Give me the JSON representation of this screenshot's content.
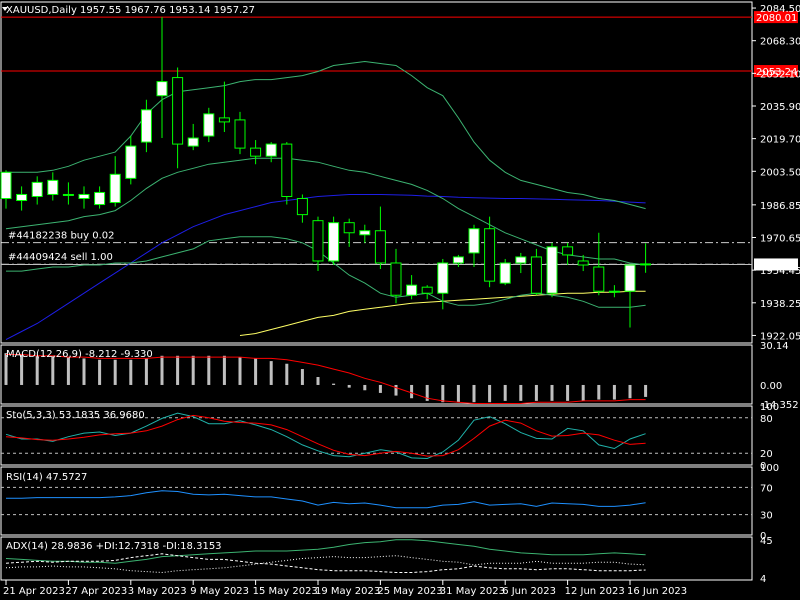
{
  "symbol_header": "XAUUSD,Daily  1957.55 1967.76 1953.14 1957.27",
  "colors": {
    "background": "#000000",
    "frame": "#ffffff",
    "bull_body": "#ffffff",
    "bear_body": "#000000",
    "wick": "#00ff00",
    "bollinger": "#3cb371",
    "ma_blue": "#1e1ee6",
    "ma_yellow": "#ffff66",
    "resistance_line": "#ff0000",
    "price_tag_red": "#ff0000",
    "macd_hist": "#c0c0c0",
    "macd_signal": "#ff0000",
    "stoch_main": "#20b2aa",
    "stoch_signal": "#ff0000",
    "rsi": "#1e90ff",
    "adx": "#3cb371",
    "di": "#ffffff",
    "level_dashed": "#ffffff"
  },
  "main_panel": {
    "price_axis_ticks": [
      "2084.50",
      "2068.30",
      "2052.10",
      "2035.90",
      "2019.70",
      "2003.50",
      "1986.85",
      "1970.65",
      "1954.45",
      "1938.25",
      "1922.05"
    ],
    "red_tags": [
      "2080.01",
      "2053.24"
    ],
    "current_price_tag": "1957.27",
    "orders": [
      {
        "label": "#44182238 buy 0.02",
        "price": 1968.1
      },
      {
        "label": "#44409424 sell 1.00",
        "price": 1957.4
      }
    ],
    "resistance_levels": [
      2080.01,
      2053.24
    ]
  },
  "macd_panel": {
    "label": "MACD(12,26,9) -8.212 -9.330",
    "axis_ticks": [
      "30.14",
      "0.00",
      "-14.352"
    ]
  },
  "stoch_panel": {
    "label": "Sto(5,3,3) 53.1835 36.9680",
    "axis_ticks": [
      "100",
      "80",
      "20",
      "0"
    ]
  },
  "rsi_panel": {
    "label": "RSI(14) 47.5727",
    "axis_ticks": [
      "100",
      "70",
      "30",
      "0"
    ]
  },
  "adx_panel": {
    "label": "ADX(14) 28.9836 +DI:12.7318 -DI:18.3153",
    "axis_ticks": [
      "45",
      "4"
    ]
  },
  "date_axis": [
    "21 Apr 2023",
    "27 Apr 2023",
    "3 May 2023",
    "9 May 2023",
    "15 May 2023",
    "19 May 2023",
    "25 May 2023",
    "31 May 2023",
    "6 Jun 2023",
    "12 Jun 2023",
    "16 Jun 2023"
  ],
  "chart_data": {
    "type": "candlestick",
    "candles": [
      {
        "o": 1990,
        "h": 2004,
        "c": 2003,
        "l": 1985
      },
      {
        "o": 1989,
        "h": 1996,
        "c": 1992,
        "l": 1984
      },
      {
        "o": 1991,
        "h": 2001,
        "c": 1998,
        "l": 1987
      },
      {
        "o": 1992,
        "h": 2003,
        "c": 1999,
        "l": 1989
      },
      {
        "o": 1992,
        "h": 1998,
        "c": 1992,
        "l": 1987
      },
      {
        "o": 1990,
        "h": 1996,
        "c": 1992,
        "l": 1985
      },
      {
        "o": 1987,
        "h": 1996,
        "c": 1993,
        "l": 1985
      },
      {
        "o": 1988,
        "h": 2011,
        "c": 2002,
        "l": 1986
      },
      {
        "o": 2000,
        "h": 2021,
        "c": 2016,
        "l": 1997
      },
      {
        "o": 2018,
        "h": 2039,
        "c": 2034,
        "l": 2013
      },
      {
        "o": 2041,
        "h": 2080,
        "c": 2048,
        "l": 2020
      },
      {
        "o": 2050,
        "h": 2055,
        "c": 2017,
        "l": 2005
      },
      {
        "o": 2016,
        "h": 2027,
        "c": 2020,
        "l": 2014
      },
      {
        "o": 2021,
        "h": 2035,
        "c": 2032,
        "l": 2018
      },
      {
        "o": 2030,
        "h": 2048,
        "c": 2028,
        "l": 2023
      },
      {
        "o": 2029,
        "h": 2033,
        "c": 2015,
        "l": 2012
      },
      {
        "o": 2015,
        "h": 2019,
        "c": 2011,
        "l": 2007
      },
      {
        "o": 2011,
        "h": 2018,
        "c": 2017,
        "l": 2008
      },
      {
        "o": 2017,
        "h": 2018,
        "c": 1991,
        "l": 1987
      },
      {
        "o": 1990,
        "h": 1992,
        "c": 1982,
        "l": 1978
      },
      {
        "o": 1979,
        "h": 1981,
        "c": 1959,
        "l": 1954
      },
      {
        "o": 1959,
        "h": 1981,
        "c": 1978,
        "l": 1957
      },
      {
        "o": 1978,
        "h": 1980,
        "c": 1973,
        "l": 1966
      },
      {
        "o": 1972,
        "h": 1977,
        "c": 1974,
        "l": 1968
      },
      {
        "o": 1974,
        "h": 1986,
        "c": 1958,
        "l": 1955
      },
      {
        "o": 1958,
        "h": 1965,
        "c": 1942,
        "l": 1938
      },
      {
        "o": 1942,
        "h": 1952,
        "c": 1947,
        "l": 1940
      },
      {
        "o": 1946,
        "h": 1947,
        "c": 1943,
        "l": 1940
      },
      {
        "o": 1943,
        "h": 1960,
        "c": 1958,
        "l": 1935
      },
      {
        "o": 1958,
        "h": 1962,
        "c": 1961,
        "l": 1956
      },
      {
        "o": 1963,
        "h": 1977,
        "c": 1975,
        "l": 1956
      },
      {
        "o": 1975,
        "h": 1981,
        "c": 1949,
        "l": 1946
      },
      {
        "o": 1948,
        "h": 1960,
        "c": 1958,
        "l": 1947
      },
      {
        "o": 1958,
        "h": 1963,
        "c": 1961,
        "l": 1953
      },
      {
        "o": 1961,
        "h": 1965,
        "c": 1943,
        "l": 1942
      },
      {
        "o": 1943,
        "h": 1968,
        "c": 1966,
        "l": 1941
      },
      {
        "o": 1966,
        "h": 1968,
        "c": 1962,
        "l": 1957
      },
      {
        "o": 1959,
        "h": 1962,
        "c": 1957,
        "l": 1954
      },
      {
        "o": 1956,
        "h": 1973,
        "c": 1944,
        "l": 1942
      },
      {
        "o": 1944,
        "h": 1947,
        "c": 1944,
        "l": 1941
      },
      {
        "o": 1944,
        "h": 1946,
        "c": 1957,
        "l": 1926
      },
      {
        "o": 1957.55,
        "h": 1967.76,
        "c": 1957.27,
        "l": 1953.14
      }
    ],
    "bollinger_upper": [
      2003,
      2003,
      2003,
      2004,
      2006,
      2009,
      2011,
      2013,
      2021,
      2032,
      2039,
      2043,
      2044,
      2045,
      2046,
      2048,
      2049,
      2049,
      2050,
      2051,
      2053,
      2056,
      2057,
      2058,
      2057,
      2056,
      2051,
      2045,
      2041,
      2030,
      2018,
      2009,
      2003,
      1999,
      1997,
      1995,
      1993,
      1992,
      1990,
      1989,
      1987,
      1985
    ],
    "bollinger_middle": [
      1975,
      1976,
      1977,
      1978,
      1979,
      1981,
      1982,
      1984,
      1989,
      1995,
      2000,
      2003,
      2005,
      2007,
      2008,
      2009,
      2010,
      2010,
      2010,
      2009,
      2008,
      2006,
      2004,
      2003,
      2001,
      1999,
      1997,
      1994,
      1990,
      1985,
      1981,
      1977,
      1973,
      1970,
      1967,
      1964,
      1962,
      1961,
      1960,
      1960,
      1958,
      1957
    ],
    "bollinger_lower": [
      1954,
      1954,
      1955,
      1956,
      1956,
      1957,
      1957,
      1958,
      1958,
      1959,
      1961,
      1963,
      1965,
      1969,
      1970,
      1971,
      1971,
      1971,
      1970,
      1968,
      1964,
      1958,
      1952,
      1948,
      1943,
      1941,
      1942,
      1943,
      1939,
      1937,
      1937,
      1938,
      1940,
      1942,
      1943,
      1942,
      1941,
      1939,
      1936,
      1936,
      1936,
      1937
    ],
    "ma_blue": [
      1920,
      1924,
      1928,
      1933,
      1938,
      1943,
      1948,
      1953,
      1958,
      1963,
      1968,
      1972,
      1976,
      1979,
      1982,
      1984,
      1986,
      1988,
      1989,
      1990,
      1991,
      1991.5,
      1992,
      1992,
      1992,
      1991.8,
      1991.6,
      1991.2,
      1991,
      1990.6,
      1990.4,
      1990.2,
      1990,
      1990,
      1989.8,
      1989.6,
      1989.4,
      1989.2,
      1989,
      1988.6,
      1988.2,
      1987.8
    ],
    "ma_yellow": [
      null,
      null,
      null,
      null,
      null,
      null,
      null,
      null,
      null,
      null,
      null,
      null,
      null,
      null,
      null,
      1922,
      1923,
      1925,
      1927,
      1929,
      1931,
      1932,
      1934,
      1935,
      1936,
      1937,
      1938,
      1938.5,
      1939,
      1939.5,
      1940,
      1940.5,
      1941,
      1941.5,
      1942,
      1942.5,
      1943,
      1943,
      1943.5,
      1943.5,
      1944,
      1944
    ],
    "macd_hist": [
      24,
      23,
      22,
      22,
      21,
      20,
      19,
      19,
      19,
      20,
      22,
      22,
      22,
      22,
      22,
      21,
      20,
      18,
      16,
      12,
      6,
      1,
      -2,
      -4,
      -6,
      -8,
      -10,
      -12,
      -13,
      -13,
      -13,
      -13,
      -12,
      -12,
      -12,
      -12,
      -12,
      -12,
      -11,
      -11,
      -10,
      -9
    ],
    "macd_signal": [
      23,
      23,
      22,
      22,
      21,
      21,
      20,
      20,
      20,
      20,
      21,
      21,
      21,
      21,
      21,
      21,
      20,
      20,
      19,
      17,
      15,
      12,
      9,
      5,
      2,
      -2,
      -6,
      -10,
      -12,
      -13,
      -14,
      -14,
      -14,
      -14,
      -13,
      -13,
      -13,
      -12,
      -12,
      -12,
      -11,
      -11
    ],
    "stoch_main": [
      52,
      44,
      44,
      40,
      48,
      54,
      56,
      50,
      54,
      66,
      79,
      88,
      82,
      70,
      70,
      75,
      68,
      60,
      48,
      34,
      24,
      16,
      14,
      20,
      26,
      22,
      12,
      11,
      22,
      42,
      76,
      82,
      70,
      55,
      45,
      44,
      62,
      58,
      34,
      28,
      44,
      53
    ],
    "stoch_signal": [
      48,
      46,
      43,
      42,
      44,
      47,
      51,
      53,
      54,
      58,
      66,
      77,
      84,
      80,
      74,
      72,
      71,
      68,
      60,
      48,
      36,
      25,
      18,
      16,
      20,
      23,
      20,
      15,
      16,
      26,
      45,
      66,
      76,
      71,
      58,
      49,
      50,
      54,
      51,
      42,
      35,
      37
    ],
    "rsi": [
      54,
      54,
      55,
      55,
      55,
      55,
      55,
      56,
      58,
      62,
      65,
      64,
      60,
      59,
      60,
      58,
      56,
      56,
      53,
      50,
      44,
      48,
      46,
      47,
      44,
      40,
      40,
      40,
      44,
      45,
      49,
      44,
      45,
      46,
      42,
      47,
      46,
      45,
      42,
      42,
      44,
      47.5
    ],
    "adx": [
      25,
      24,
      23,
      22,
      22,
      21,
      21,
      20,
      22,
      24,
      27,
      28,
      29,
      30,
      31,
      32,
      33,
      33,
      33,
      34,
      35,
      37,
      40,
      42,
      43,
      45,
      45,
      44,
      42,
      40,
      38,
      35,
      33,
      31,
      30,
      29,
      29,
      29,
      30,
      31,
      30,
      29
    ],
    "plus_di": [
      20,
      21,
      22,
      21,
      22,
      22,
      22,
      23,
      26,
      28,
      30,
      28,
      26,
      24,
      24,
      22,
      20,
      19,
      17,
      15,
      13,
      12,
      12,
      12,
      11,
      10,
      10,
      11,
      13,
      14,
      17,
      15,
      14,
      14,
      13,
      14,
      14,
      13,
      12,
      12,
      12,
      12.7
    ],
    "minus_di": [
      15,
      16,
      16,
      17,
      16,
      16,
      15,
      14,
      12,
      11,
      10,
      12,
      13,
      14,
      15,
      17,
      19,
      21,
      23,
      25,
      26,
      27,
      26,
      26,
      27,
      28,
      26,
      24,
      22,
      21,
      18,
      20,
      20,
      20,
      22,
      20,
      20,
      20,
      21,
      21,
      19,
      18.3
    ]
  }
}
